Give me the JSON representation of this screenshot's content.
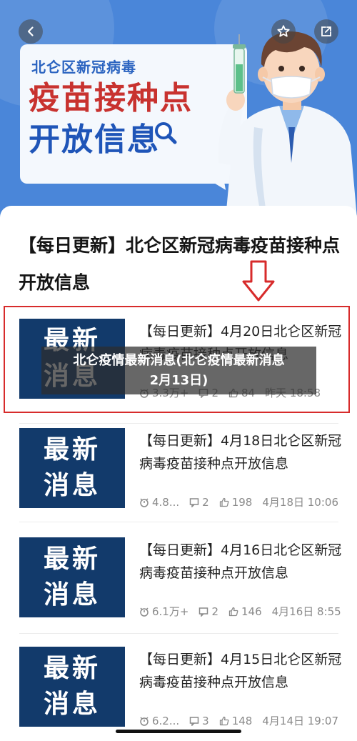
{
  "colors": {
    "banner_bg": "#4a86d9",
    "accent_red": "#c8322f",
    "accent_blue": "#1f55b8",
    "thumb_bg": "#123a6b"
  },
  "header": {
    "back_icon": "chevron-left-icon",
    "favorite_icon": "star-icon",
    "share_icon": "share-icon"
  },
  "banner": {
    "subtitle": "北仑区新冠病毒",
    "title_line1": "疫苗接种点",
    "title_line2": "开放信息"
  },
  "article": {
    "title": "【每日更新】北仑区新冠病毒疫苗接种点开放信息"
  },
  "overlay": {
    "line1": "北仑疫情最新消息(北仑疫情最新消息",
    "line2": "2月13日)"
  },
  "items": [
    {
      "thumb_line1": "最新",
      "thumb_line2": "消息",
      "title": "【每日更新】4月20日北仑区新冠病毒疫苗接种点开放信息",
      "views": "3.3万+",
      "comments": "2",
      "likes": "84",
      "date": "昨天 18:58"
    },
    {
      "thumb_line1": "最新",
      "thumb_line2": "消息",
      "title": "【每日更新】4月18日北仑区新冠病毒疫苗接种点开放信息",
      "views": "4.8...",
      "comments": "2",
      "likes": "198",
      "date": "4月18日 10:06"
    },
    {
      "thumb_line1": "最新",
      "thumb_line2": "消息",
      "title": "【每日更新】4月16日北仑区新冠病毒疫苗接种点开放信息",
      "views": "6.1万+",
      "comments": "2",
      "likes": "146",
      "date": "4月16日 8:55"
    },
    {
      "thumb_line1": "最新",
      "thumb_line2": "消息",
      "title": "【每日更新】4月15日北仑区新冠病毒疫苗接种点开放信息",
      "views": "6.2...",
      "comments": "3",
      "likes": "148",
      "date": "4月14日 19:07"
    }
  ]
}
